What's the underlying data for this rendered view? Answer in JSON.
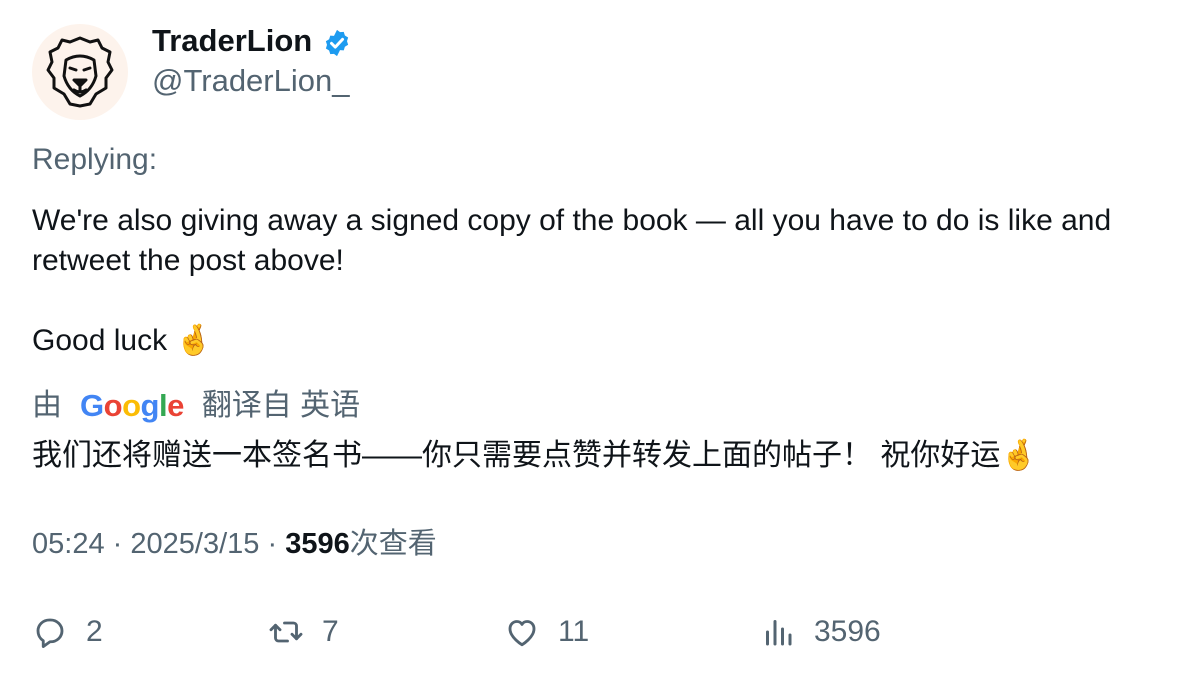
{
  "author": {
    "display_name": "TraderLion",
    "handle": "@TraderLion_",
    "verified": true,
    "verified_color": "#1d9bf0"
  },
  "replying_label": "Replying:",
  "tweet": {
    "paragraph_1": "We're also giving away a signed copy of the book — all you have to do is like and retweet the post above!",
    "paragraph_2": "Good luck 🤞"
  },
  "translation": {
    "prefix": "由",
    "provider": "Google",
    "suffix": "翻译自 英语",
    "text": "我们还将赠送一本签名书——你只需要点赞并转发上面的帖子！ 祝你好运🤞"
  },
  "meta": {
    "time": "05:24",
    "separator": "·",
    "date": "2025/3/15",
    "views_count": "3596",
    "views_label": "次查看"
  },
  "actions": {
    "replies": "2",
    "retweets": "7",
    "likes": "11",
    "views": "3596"
  },
  "icons": {
    "avatar": "lion-logo",
    "verified": "verified-badge-icon",
    "reply": "reply-icon",
    "retweet": "retweet-icon",
    "like": "heart-icon",
    "views": "analytics-icon"
  }
}
